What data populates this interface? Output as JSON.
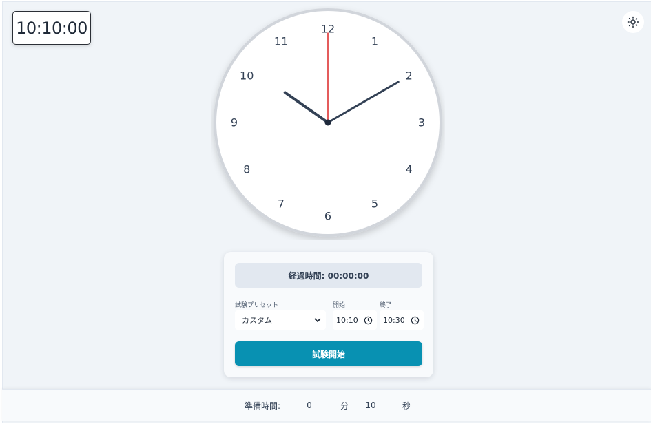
{
  "digital_clock": {
    "time": "10:10:00"
  },
  "theme_toggle": {
    "icon": "sun-icon"
  },
  "analog_clock": {
    "numerals": [
      "12",
      "1",
      "2",
      "3",
      "4",
      "5",
      "6",
      "7",
      "8",
      "9",
      "10",
      "11"
    ],
    "time": {
      "hours": 10,
      "minutes": 10,
      "seconds": 0
    },
    "colors": {
      "face": "#ffffff",
      "rim": "#d1d5db",
      "hands": "#334155",
      "second_hand": "#dc2626",
      "numerals": "#334155"
    }
  },
  "panel": {
    "elapsed": "経過時間: 00:00:00",
    "preset_label": "試験プリセット",
    "preset_value": "カスタム",
    "start_label": "開始",
    "start_value": "10:10",
    "end_label": "終了",
    "end_value": "10:30",
    "start_button": "試験開始"
  },
  "footer": {
    "prep_label": "準備時間:",
    "minutes_value": "0",
    "minutes_unit": "分",
    "seconds_value": "10",
    "seconds_unit": "秒"
  },
  "colors": {
    "accent": "#0891b2",
    "background": "#f0f4f8"
  }
}
